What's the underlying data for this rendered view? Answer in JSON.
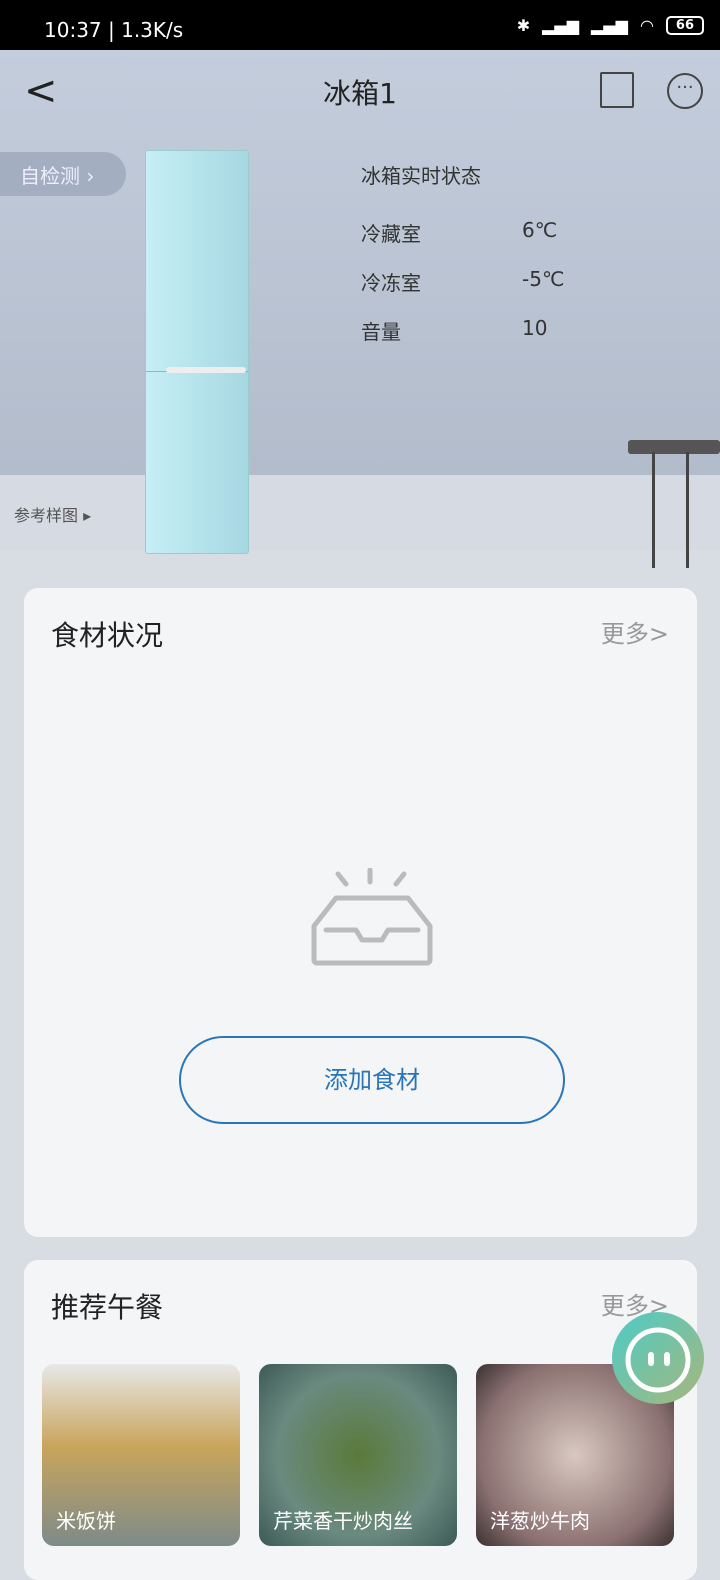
{
  "status_bar": {
    "time": "10:37 | 1.3K/s",
    "battery": "66"
  },
  "header": {
    "title": "冰箱1"
  },
  "hero": {
    "self_check": "自检测",
    "status_title": "冰箱实时状态",
    "rows": [
      {
        "label": "冷藏室",
        "value": "6℃"
      },
      {
        "label": "冷冻室",
        "value": "-5℃"
      },
      {
        "label": "音量",
        "value": "10"
      }
    ],
    "reference": "参考样图 ▸"
  },
  "food": {
    "title": "食材状况",
    "more": "更多>",
    "add_button": "添加食材"
  },
  "lunch": {
    "title": "推荐午餐",
    "more": "更多>",
    "recipes": [
      {
        "name": "米饭饼"
      },
      {
        "name": "芹菜香干炒肉丝"
      },
      {
        "name": "洋葱炒牛肉"
      }
    ]
  },
  "colors": {
    "accent": "#2a75b8"
  }
}
